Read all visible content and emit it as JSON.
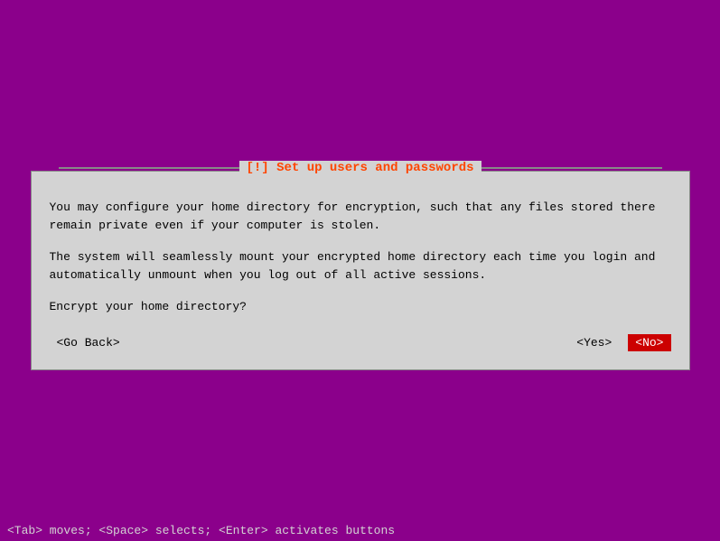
{
  "title": "[!] Set up users and passwords",
  "body": {
    "paragraph1": "You may configure your home directory for encryption, such that any files stored there\nremain private even if your computer is stolen.",
    "paragraph2": "The system will seamlessly mount your encrypted home directory each time you login and\nautomatically unmount when you log out of all active sessions.",
    "question": "Encrypt your home directory?"
  },
  "buttons": {
    "go_back": "<Go Back>",
    "yes": "<Yes>",
    "no": "<No>"
  },
  "status_bar": "<Tab> moves; <Space> selects; <Enter> activates buttons"
}
